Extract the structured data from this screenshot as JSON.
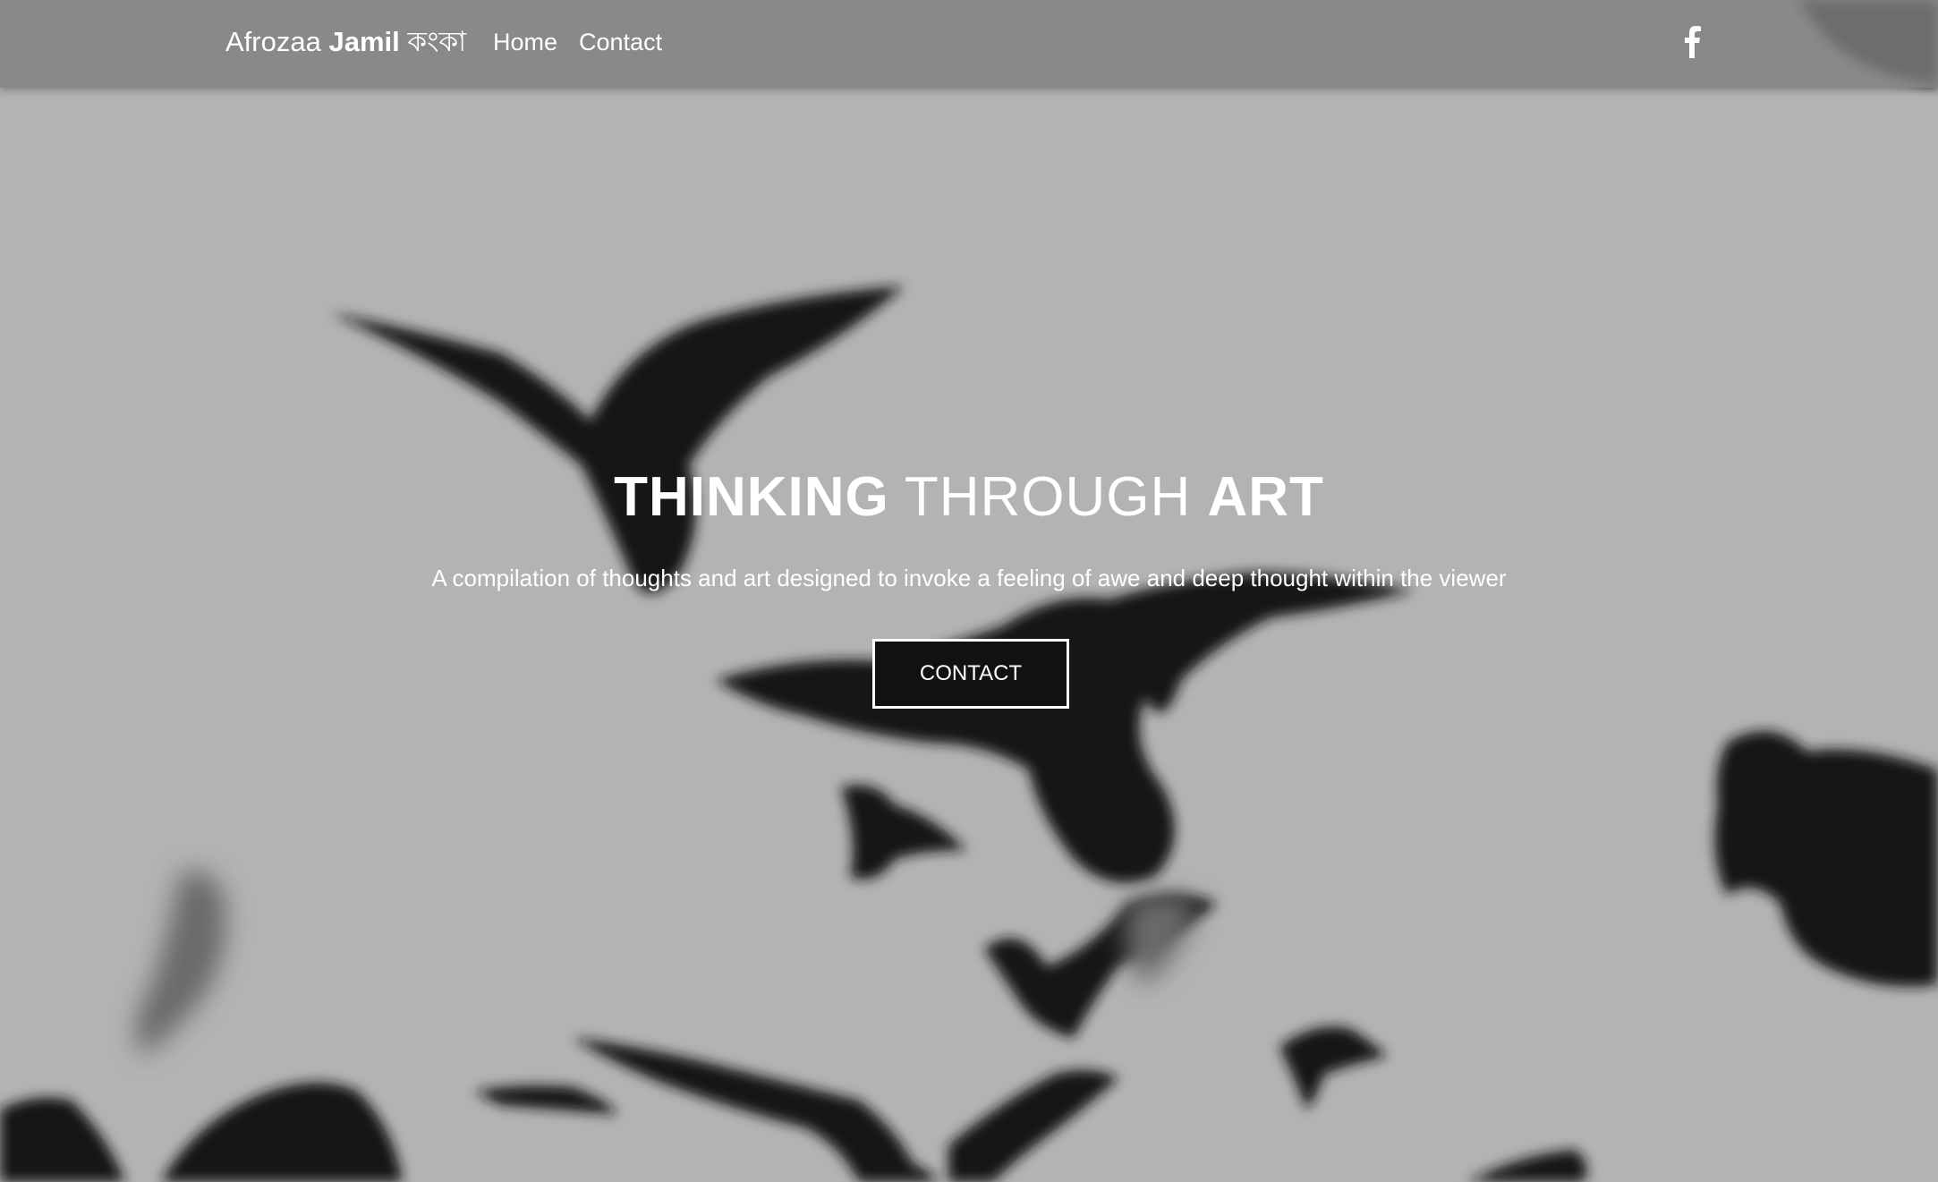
{
  "nav": {
    "brand_light": "Afrozaa",
    "brand_bold": "Jamil",
    "brand_bengali": "কংকা",
    "links": [
      {
        "label": "Home"
      },
      {
        "label": "Contact"
      }
    ],
    "social_icon": "facebook-icon"
  },
  "hero": {
    "title_part1": "THINKING",
    "title_part2": "THROUGH",
    "title_part3": "ART",
    "subtitle": "A compilation of thoughts and art designed to invoke a feeling of awe and deep thought within the viewer",
    "cta_label": "CONTACT"
  },
  "colors": {
    "background": "#b3b3b3",
    "navbar": "#808080",
    "text": "#ffffff",
    "button_bg": "#111111"
  }
}
